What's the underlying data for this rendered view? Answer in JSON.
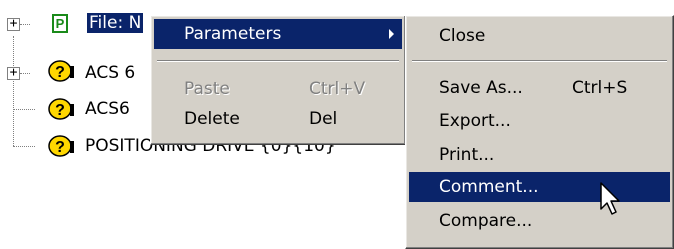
{
  "tree": {
    "items": [
      {
        "label": "File: N",
        "selected": true,
        "icon": "p-file-icon",
        "expander": "+"
      },
      {
        "label": "ACS 6",
        "icon": "help-drive-icon",
        "expander": "+"
      },
      {
        "label": "ACS6",
        "icon": "help-drive-icon"
      },
      {
        "label": "POSITIONING DRIVE {0}{10}",
        "icon": "help-drive-icon"
      }
    ]
  },
  "context_menu": {
    "items": [
      {
        "label": "Parameters",
        "has_submenu": true,
        "active": true
      },
      {
        "label": "Paste",
        "shortcut": "Ctrl+V",
        "disabled": true
      },
      {
        "label": "Delete",
        "shortcut": "Del"
      }
    ]
  },
  "submenu": {
    "items": [
      {
        "label": "Close"
      },
      {
        "label": "Save As...",
        "shortcut": "Ctrl+S"
      },
      {
        "label": "Export..."
      },
      {
        "label": "Print..."
      },
      {
        "label": "Comment...",
        "active": true
      },
      {
        "label": "Compare..."
      }
    ]
  },
  "colors": {
    "menu_bg": "#d4d0c8",
    "highlight": "#0a246a",
    "icon_green": "#1a8a1a",
    "icon_yellow": "#ffd700"
  }
}
